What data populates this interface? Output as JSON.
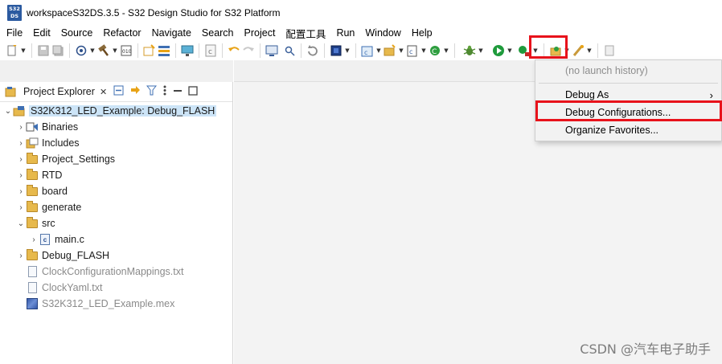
{
  "window": {
    "logo_text_top": "S32",
    "logo_text_bottom": "DS",
    "title": "workspaceS32DS.3.5 - S32 Design Studio for S32 Platform"
  },
  "menubar": {
    "items": [
      "File",
      "Edit",
      "Source",
      "Refactor",
      "Navigate",
      "Search",
      "Project",
      "配置工具",
      "Run",
      "Window",
      "Help"
    ]
  },
  "toolbar": {
    "icons": [
      "new-icon",
      "save-icon",
      "save-all-icon",
      "debug-settings-icon",
      "build-hammer-icon",
      "binary-icon",
      "new-folder-icon",
      "layers-icon",
      "monitor-icon",
      "c-file-icon",
      "undo-icon",
      "redo-icon",
      "console-icon",
      "search-tool-icon",
      "debug-bug-icon",
      "run-icon",
      "run-external-icon",
      "open-perspective-icon"
    ],
    "highlight_color": "#e8121b"
  },
  "project_explorer": {
    "title": "Project Explorer",
    "close_glyph": "✕",
    "tree": [
      {
        "label": "S32K312_LED_Example: Debug_FLASH",
        "level": 0,
        "expanded": true,
        "icon": "project-icon",
        "selected": true
      },
      {
        "label": "Binaries",
        "level": 1,
        "expanded": false,
        "icon": "binaries-icon"
      },
      {
        "label": "Includes",
        "level": 1,
        "expanded": false,
        "icon": "includes-icon"
      },
      {
        "label": "Project_Settings",
        "level": 1,
        "expanded": false,
        "icon": "folder-icon"
      },
      {
        "label": "RTD",
        "level": 1,
        "expanded": false,
        "icon": "folder-icon"
      },
      {
        "label": "board",
        "level": 1,
        "expanded": false,
        "icon": "folder-icon"
      },
      {
        "label": "generate",
        "level": 1,
        "expanded": false,
        "icon": "folder-icon"
      },
      {
        "label": "src",
        "level": 1,
        "expanded": true,
        "icon": "folder-icon"
      },
      {
        "label": "main.c",
        "level": 2,
        "expanded": false,
        "icon": "c-source-icon"
      },
      {
        "label": "Debug_FLASH",
        "level": 1,
        "expanded": false,
        "icon": "folder-icon"
      },
      {
        "label": "ClockConfigurationMappings.txt",
        "level": 1,
        "icon": "text-file-icon",
        "muted": true
      },
      {
        "label": "ClockYaml.txt",
        "level": 1,
        "icon": "text-file-icon",
        "muted": true
      },
      {
        "label": "S32K312_LED_Example.mex",
        "level": 1,
        "icon": "mex-file-icon",
        "muted": true
      }
    ]
  },
  "debug_dropdown": {
    "items": [
      {
        "label": "(no launch history)",
        "disabled": true
      },
      {
        "label": "Debug As",
        "submenu": true
      },
      {
        "label": "Debug Configurations...",
        "highlighted": true
      },
      {
        "label": "Organize Favorites..."
      }
    ]
  },
  "watermark": "CSDN @汽车电子助手"
}
